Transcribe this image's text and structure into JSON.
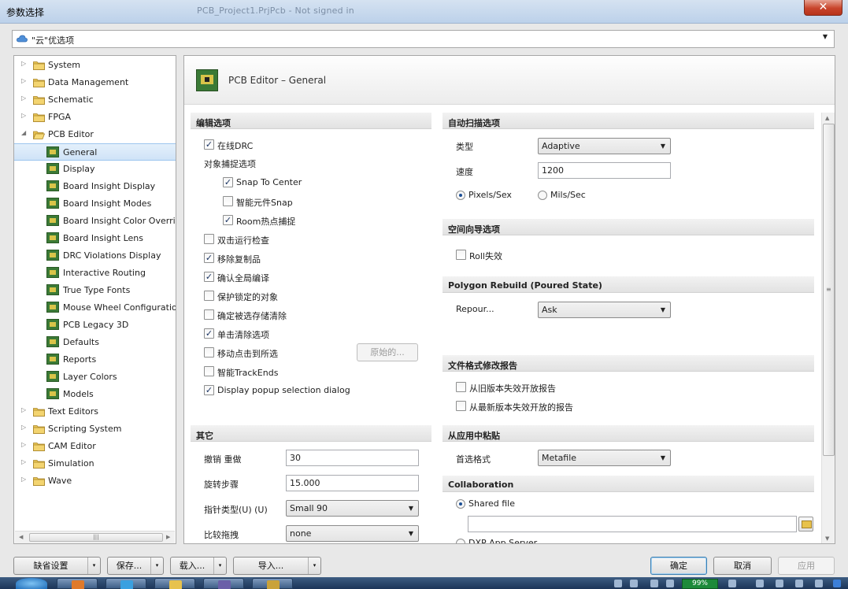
{
  "window": {
    "title": "参数选择",
    "title_ghost": "PCB_Project1.PrjPcb - Not signed in",
    "close_glyph": "✕"
  },
  "cloud_dropdown": {
    "value": "\"云\"优选项",
    "icon": "cloud-icon"
  },
  "tree": {
    "items": [
      {
        "label": "System",
        "level": 0,
        "expander": "▷",
        "icon": "folder-icon"
      },
      {
        "label": "Data Management",
        "level": 0,
        "expander": "▷",
        "icon": "folder-icon"
      },
      {
        "label": "Schematic",
        "level": 0,
        "expander": "▷",
        "icon": "folder-icon"
      },
      {
        "label": "FPGA",
        "level": 0,
        "expander": "▷",
        "icon": "folder-icon"
      },
      {
        "label": "PCB Editor",
        "level": 0,
        "expander": "◢",
        "icon": "folder-open-icon"
      },
      {
        "label": "General",
        "level": 1,
        "selected": true,
        "icon": "pcb-icon"
      },
      {
        "label": "Display",
        "level": 1,
        "icon": "pcb-icon"
      },
      {
        "label": "Board Insight Display",
        "level": 1,
        "icon": "pcb-icon"
      },
      {
        "label": "Board Insight Modes",
        "level": 1,
        "icon": "pcb-icon"
      },
      {
        "label": "Board Insight Color Overrid",
        "level": 1,
        "icon": "pcb-icon"
      },
      {
        "label": "Board Insight Lens",
        "level": 1,
        "icon": "pcb-icon"
      },
      {
        "label": "DRC Violations Display",
        "level": 1,
        "icon": "pcb-icon"
      },
      {
        "label": "Interactive Routing",
        "level": 1,
        "icon": "pcb-icon"
      },
      {
        "label": "True Type Fonts",
        "level": 1,
        "icon": "pcb-icon"
      },
      {
        "label": "Mouse Wheel Configuration",
        "level": 1,
        "icon": "pcb-icon"
      },
      {
        "label": "PCB Legacy 3D",
        "level": 1,
        "icon": "pcb-icon"
      },
      {
        "label": "Defaults",
        "level": 1,
        "icon": "pcb-icon"
      },
      {
        "label": "Reports",
        "level": 1,
        "icon": "pcb-icon"
      },
      {
        "label": "Layer Colors",
        "level": 1,
        "icon": "pcb-icon"
      },
      {
        "label": "Models",
        "level": 1,
        "icon": "pcb-icon"
      },
      {
        "label": "Text Editors",
        "level": 0,
        "expander": "▷",
        "icon": "folder-icon"
      },
      {
        "label": "Scripting System",
        "level": 0,
        "expander": "▷",
        "icon": "folder-icon"
      },
      {
        "label": "CAM Editor",
        "level": 0,
        "expander": "▷",
        "icon": "folder-icon"
      },
      {
        "label": "Simulation",
        "level": 0,
        "expander": "▷",
        "icon": "folder-icon"
      },
      {
        "label": "Wave",
        "level": 0,
        "expander": "▷",
        "icon": "folder-icon"
      }
    ],
    "scroll_left": "◀",
    "scroll_right": "▶",
    "scroll_grip": "|||"
  },
  "panel": {
    "title": "PCB Editor – General",
    "edit_options": {
      "header": "编辑选项",
      "online_drc": {
        "label": "在线DRC",
        "checked": true
      },
      "snap_header": "对象捕捉选项",
      "snap_to_center": {
        "label": "Snap To Center",
        "checked": true
      },
      "smart_component_snap": {
        "label": "智能元件Snap",
        "checked": false
      },
      "room_hotspot_snap": {
        "label": "Room热点捕捉",
        "checked": true
      },
      "double_click_inspect": {
        "label": "双击运行检查",
        "checked": false
      },
      "remove_duplicates": {
        "label": "移除复制品",
        "checked": true
      },
      "confirm_global_edit": {
        "label": "确认全局编译",
        "checked": true
      },
      "protect_locked": {
        "label": "保护锁定的对象",
        "checked": false
      },
      "confirm_selection_clear": {
        "label": "确定被选存储清除",
        "checked": false
      },
      "click_clears_selection": {
        "label": "单击清除选项",
        "checked": true
      },
      "move_click_to_selected": {
        "label": "移动点击到所选",
        "checked": false
      },
      "original_button": "原始的...",
      "smart_trackends": {
        "label": "智能TrackEnds",
        "checked": false
      },
      "display_popup": {
        "label": "Display popup selection dialog",
        "checked": true
      }
    },
    "other": {
      "header": "其它",
      "undo_redo_label": "撤销 重做",
      "undo_redo_value": "30",
      "rotation_step_label": "旋转步骤",
      "rotation_step_value": "15.000",
      "cursor_type_label": "指针类型(U) (U)",
      "cursor_type_value": "Small 90",
      "compare_drag_label": "比较拖拽",
      "compare_drag_value": "none"
    },
    "autopan": {
      "header": "自动扫描选项",
      "type_label": "类型",
      "type_value": "Adaptive",
      "speed_label": "速度",
      "speed_value": "1200",
      "unit_pixels": {
        "label": "Pixels/Sex",
        "selected": true
      },
      "unit_mils": {
        "label": "Mils/Sec",
        "selected": false
      }
    },
    "space_navigator": {
      "header": "空间向导选项",
      "roll_disabled": {
        "label": "Roll失效",
        "checked": false
      }
    },
    "polygon_rebuild": {
      "header": "Polygon Rebuild (Poured State)",
      "repour_label": "Repour...",
      "repour_value": "Ask"
    },
    "file_format": {
      "header": "文件格式修改报告",
      "old_version": {
        "label": "从旧版本失效开放报告",
        "checked": false
      },
      "new_version": {
        "label": "从最新版本失效开放的报告",
        "checked": false
      }
    },
    "paste": {
      "header": "从应用中粘贴",
      "preferred_format_label": "首选格式",
      "preferred_format_value": "Metafile"
    },
    "collaboration": {
      "header": "Collaboration",
      "shared_file": {
        "label": "Shared file",
        "selected": true
      },
      "shared_path_value": "",
      "dxp_server": {
        "label": "DXP App Server",
        "selected": false
      }
    },
    "scroll_up": "▲",
    "scroll_down": "▼",
    "scroll_grip": "≡"
  },
  "bottom_bar": {
    "defaults": "缺省设置",
    "save": "保存...",
    "load": "载入...",
    "import": "导入...",
    "ok": "确定",
    "cancel": "取消",
    "apply": "应用",
    "split_arrow": "▾"
  },
  "taskbar": {
    "battery": "99%"
  }
}
